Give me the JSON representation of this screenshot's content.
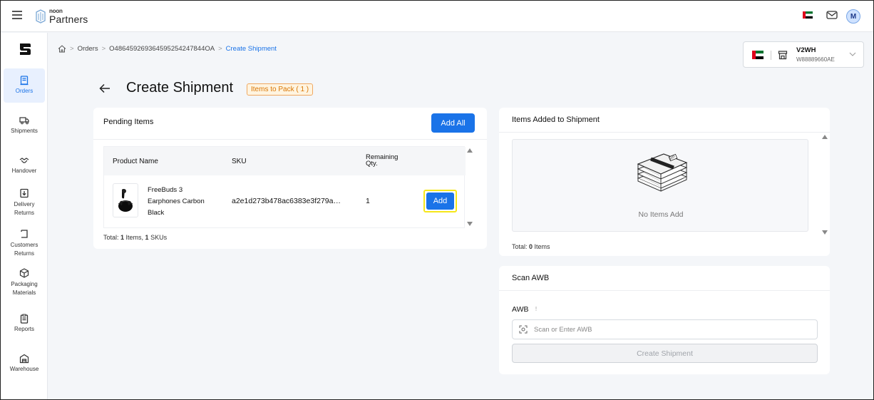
{
  "app": {
    "brand_small": "noon",
    "brand_big": "Partners",
    "avatar_initial": "M",
    "icons": [
      "menu-icon",
      "noon-logo-icon",
      "uae-flag-icon",
      "mail-icon"
    ]
  },
  "sidebar": {
    "items": [
      {
        "label": "Orders",
        "icon": "orders-icon",
        "active": true
      },
      {
        "label": "Shipments",
        "icon": "truck-icon"
      },
      {
        "label": "Handover",
        "icon": "handshake-icon"
      },
      {
        "label": "Delivery Returns",
        "icon": "delivery-returns-icon"
      },
      {
        "label": "Customers Returns",
        "icon": "customer-returns-icon"
      },
      {
        "label": "Packaging Materials",
        "icon": "box-icon"
      },
      {
        "label": "Reports",
        "icon": "clipboard-icon"
      },
      {
        "label": "Warehouse",
        "icon": "warehouse-icon"
      }
    ]
  },
  "breadcrumb": {
    "items": [
      "Orders",
      "O486459269364595254247844OA"
    ],
    "current": "Create Shipment",
    "separator": ">"
  },
  "warehouse": {
    "code": "V2WH",
    "id": "W88889660AE"
  },
  "page": {
    "title": "Create Shipment",
    "badge": "Items to Pack ( 1 )"
  },
  "pending": {
    "title": "Pending Items",
    "add_all_label": "Add All",
    "columns": {
      "product_name": "Product Name",
      "sku": "SKU",
      "remaining_line1": "Remaining",
      "remaining_line2": "Qty."
    },
    "rows": [
      {
        "name_line1": "FreeBuds 3",
        "name_line2": "Earphones Carbon",
        "name_line3": "Black",
        "sku": "a2e1d273b478ac6383e3f279a…",
        "qty": "1",
        "add_label": "Add"
      }
    ],
    "total_prefix": "Total: ",
    "total_items_count": "1",
    "total_items_word": " Items, ",
    "total_skus_count": "1",
    "total_skus_word": " SKUs"
  },
  "added": {
    "title": "Items Added to Shipment",
    "empty_text": "No Items Add",
    "total_prefix": "Total: ",
    "total_count": "0",
    "total_word": " Items"
  },
  "scan": {
    "title": "Scan AWB",
    "awb_label": "AWB",
    "info_glyph": "!",
    "awb_placeholder": "Scan or Enter AWB",
    "awb_value": "",
    "create_label": "Create Shipment"
  },
  "colors": {
    "accent": "#1a73e8",
    "badge_text": "#d97706",
    "badge_bg": "#fff4e0",
    "highlight": "#f6e71a"
  }
}
